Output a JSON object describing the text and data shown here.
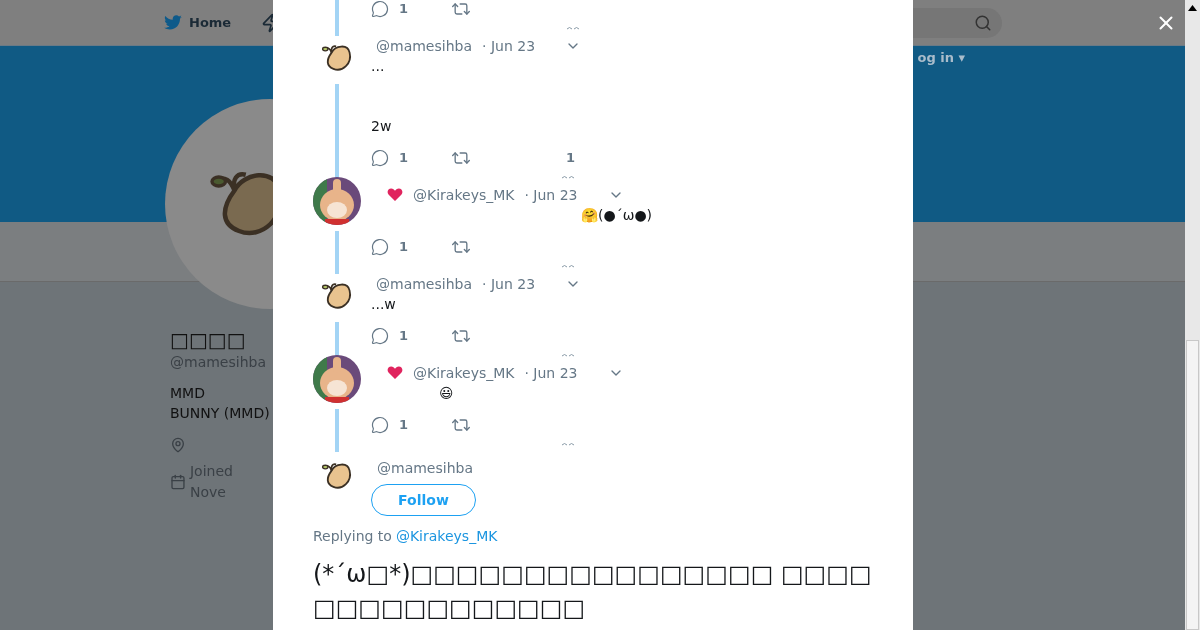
{
  "nav": {
    "home": "Home",
    "login": "og in ▾"
  },
  "profile": {
    "name": "□□□□",
    "handle": "@mamesihba",
    "bio": [
      "MMD",
      "BUNNY (MMD)"
    ],
    "joined": "Joined Nove"
  },
  "thread": [
    {
      "kind": "actions-only",
      "replies": "1"
    },
    {
      "kind": "tweet",
      "avatar": {
        "kind": "bean"
      },
      "user": "@mamesihba",
      "date": "· Jun 23",
      "heart": false,
      "text": "...\n\n\n2w",
      "replies": "1",
      "likes": "1"
    },
    {
      "kind": "tweet",
      "avatar": {
        "kind": "bunny"
      },
      "user": "@Kirakeys_MK",
      "date": "· Jun 23",
      "heart": true,
      "text": "🤗(●´ω●)",
      "replies": "1"
    },
    {
      "kind": "tweet",
      "avatar": {
        "kind": "bean"
      },
      "user": "@mamesihba",
      "date": "· Jun 23",
      "heart": false,
      "text": "...w",
      "replies": "1"
    },
    {
      "kind": "tweet",
      "avatar": {
        "kind": "bunny"
      },
      "user": "@Kirakeys_MK",
      "date": "· Jun 23",
      "heart": true,
      "text": "😃",
      "replies": "1"
    }
  ],
  "main": {
    "user": "@mamesihba",
    "follow": "Follow",
    "replying_label": "Replying to",
    "replying_to": "@Kirakeys_MK",
    "text": "(*´ω□*)□□□□□□□□□□□□□□□□ □□□□□□□□□□□□□□□□"
  }
}
